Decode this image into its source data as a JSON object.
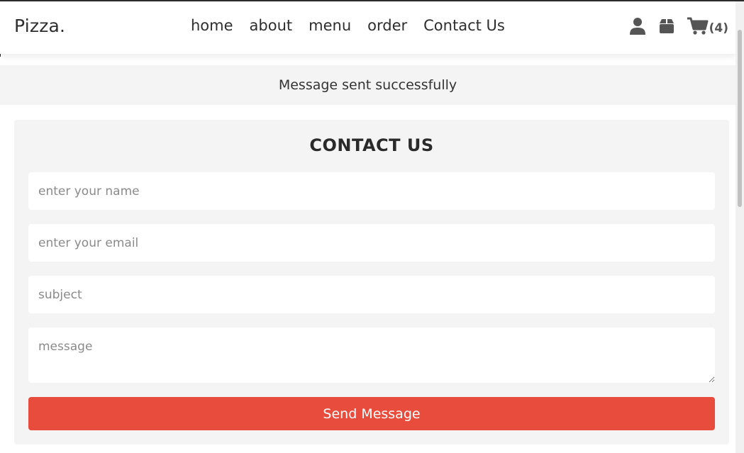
{
  "header": {
    "logo": "Pizza.",
    "nav": [
      "home",
      "about",
      "menu",
      "order",
      "Contact Us"
    ],
    "cart_count": "(4)",
    "icons": [
      "user-icon",
      "box-icon",
      "cart-icon"
    ]
  },
  "message": "Message sent successfully",
  "contact": {
    "title": "CONTACT US",
    "name_placeholder": "enter your name",
    "email_placeholder": "enter your email",
    "subject_placeholder": "subject",
    "message_placeholder": "message",
    "send_label": "Send Message"
  },
  "colors": {
    "accent": "#e74c3c",
    "panel": "#f4f4f4",
    "text": "#2e2e2e"
  }
}
